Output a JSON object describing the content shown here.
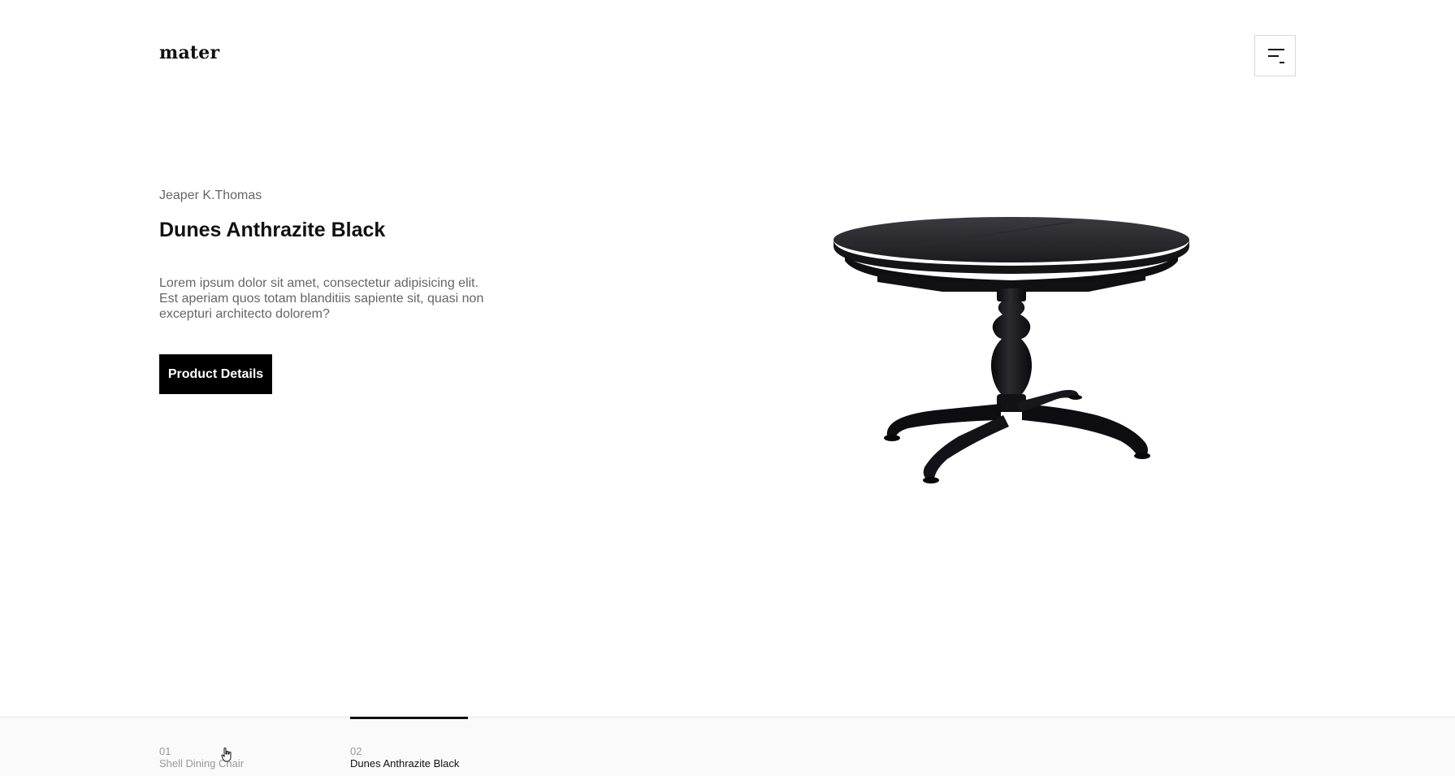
{
  "header": {
    "logo_text": "mater",
    "menu_icon": "menu-lines-icon"
  },
  "hero": {
    "author": "Jeaper K.Thomas",
    "title": "Dunes Anthrazite Black",
    "description": "Lorem ipsum dolor sit amet, consectetur adipisicing elit. Est aperiam quos totam blanditiis sapiente sit, quasi non excepturi architecto dolorem?",
    "button_label": "Product Details",
    "image_alt": "round-black-pedestal-dining-table"
  },
  "slides": [
    {
      "number": "01",
      "label": "Shell Dining Chair",
      "active": false
    },
    {
      "number": "02",
      "label": "Dunes Anthrazite Black",
      "active": true
    }
  ],
  "colors": {
    "background": "#ffffff",
    "text": "#111111",
    "muted": "#666666",
    "button_bg": "#000000",
    "button_text": "#ffffff",
    "bottom_bar": "#fafafa"
  },
  "cursor_icon": "hand-pointer-icon"
}
